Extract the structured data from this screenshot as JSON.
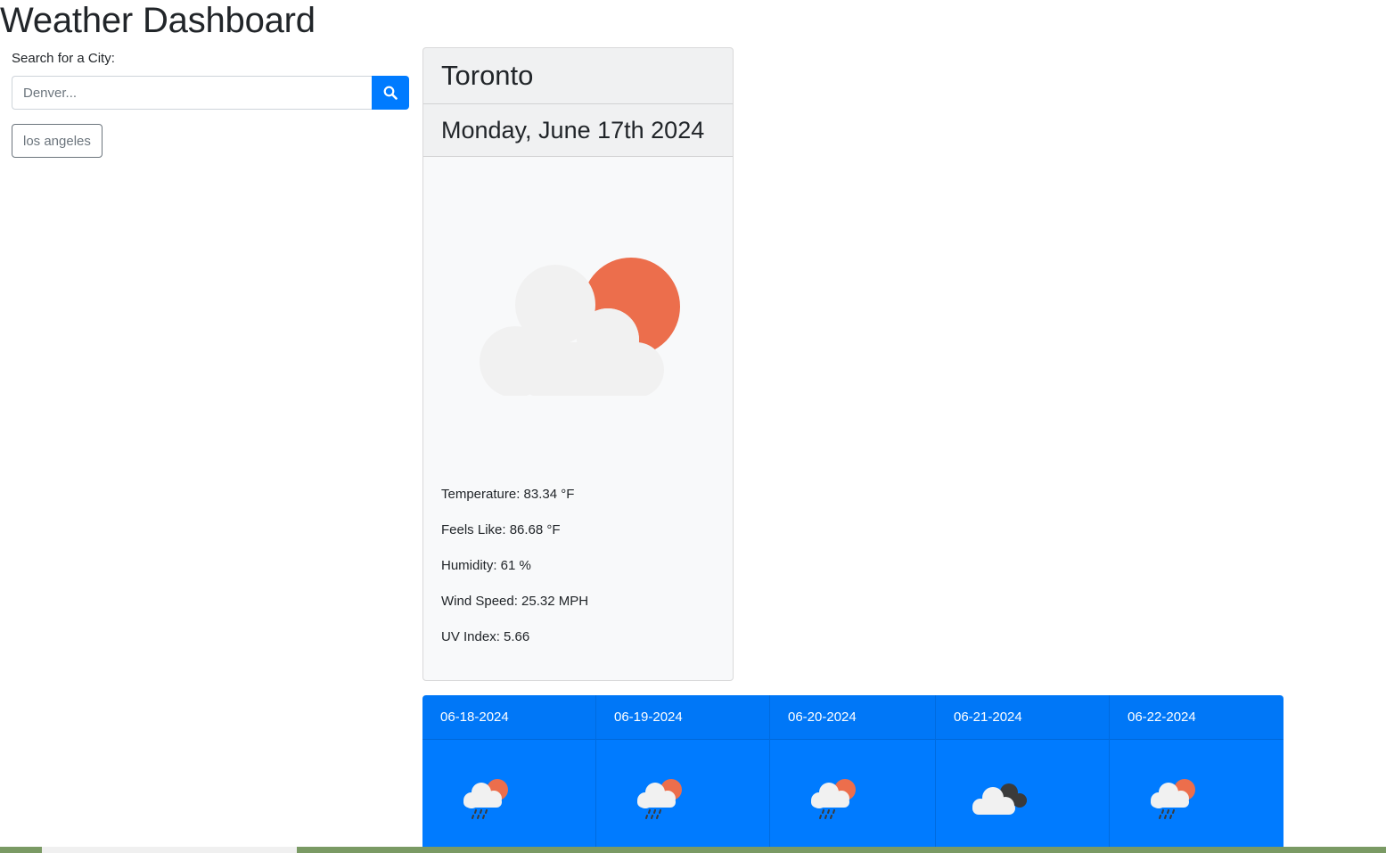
{
  "header": {
    "title": "Weather Dashboard"
  },
  "search": {
    "label": "Search for a City:",
    "placeholder": "Denver...",
    "value": "",
    "button_icon": "search-icon",
    "history": [
      "los angeles"
    ]
  },
  "current": {
    "city": "Toronto",
    "date": "Monday, June 17th 2024",
    "icon": "partly-cloudy-day-icon",
    "temperature": "Temperature: 83.34 °F",
    "feels_like": "Feels Like: 86.68 °F",
    "humidity": "Humidity: 61 %",
    "wind_speed": "Wind Speed: 25.32 MPH",
    "uv_index": "UV Index: 5.66"
  },
  "forecast": [
    {
      "date": "06-18-2024",
      "icon": "rain-with-sun-icon"
    },
    {
      "date": "06-19-2024",
      "icon": "rain-with-sun-icon"
    },
    {
      "date": "06-20-2024",
      "icon": "rain-with-sun-icon"
    },
    {
      "date": "06-21-2024",
      "icon": "dark-cloud-icon"
    },
    {
      "date": "06-22-2024",
      "icon": "rain-with-sun-icon"
    }
  ],
  "colors": {
    "primary": "#007bff",
    "sun": "#ec6e4c",
    "cloud": "#f1f1f1",
    "dark_cloud": "#3b3b3b"
  }
}
